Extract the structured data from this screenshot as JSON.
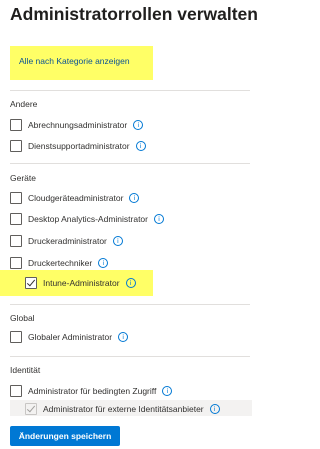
{
  "page": {
    "title": "Administratorrollen verwalten"
  },
  "toolbar": {
    "show_by_category": "Alle nach Kategorie anzeigen"
  },
  "groups": [
    {
      "title": "Andere",
      "roles": [
        {
          "label": "Abrechnungsadministrator",
          "checked": false
        },
        {
          "label": "Dienstsupportadministrator",
          "checked": false
        }
      ]
    },
    {
      "title": "Geräte",
      "roles": [
        {
          "label": "Cloudgeräteadministrator",
          "checked": false
        },
        {
          "label": "Desktop Analytics-Administrator",
          "checked": false
        },
        {
          "label": "Druckeradministrator",
          "checked": false
        },
        {
          "label": "Druckertechniker",
          "checked": false
        },
        {
          "label": "Intune-Administrator",
          "checked": true
        }
      ]
    },
    {
      "title": "Global",
      "roles": [
        {
          "label": "Globaler Administrator",
          "checked": false
        }
      ]
    },
    {
      "title": "Identität",
      "roles": [
        {
          "label": "Administrator für bedingten Zugriff",
          "checked": false
        },
        {
          "label": "Administrator für externe Identitätsanbieter",
          "checked": true,
          "disabled": true
        }
      ]
    }
  ],
  "info_glyph": "i",
  "footer": {
    "save_label": "Änderungen speichern"
  },
  "colors": {
    "highlight": "#ffff66",
    "accent": "#0078d4",
    "link": "#0b5394"
  }
}
